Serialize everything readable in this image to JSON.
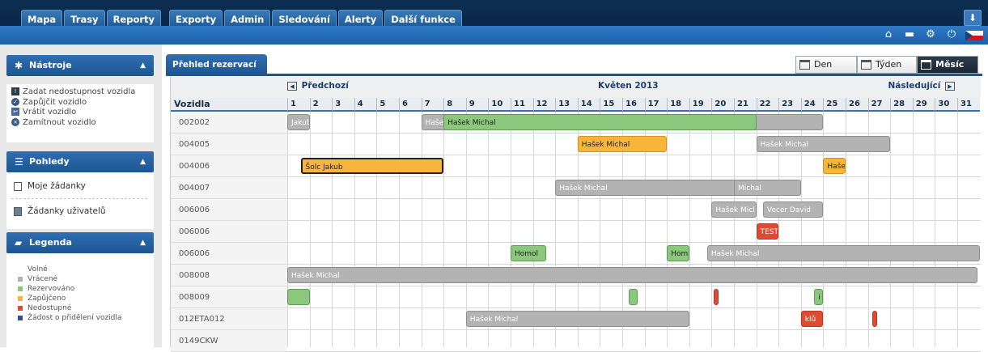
{
  "nav": [
    "Mapa",
    "Trasy",
    "Reporty",
    "Exporty",
    "Admin",
    "Sledování",
    "Alerty",
    "Další funkce"
  ],
  "tools_panel": {
    "title": "Nástroje",
    "items": [
      "Zadat nedostupnost vozidla",
      "Zapůjčit vozidlo",
      "Vrátit vozidlo",
      "Zamítnout vozidlo"
    ]
  },
  "views_panel": {
    "title": "Pohledy",
    "items": [
      "Moje žádanky",
      "Žádanky uživatelů"
    ]
  },
  "legend_panel": {
    "title": "Legenda",
    "items": [
      {
        "label": "Volné",
        "color": "#ffffff"
      },
      {
        "label": "Vrácené",
        "color": "#b3b3b3"
      },
      {
        "label": "Rezervováno",
        "color": "#8bc77c"
      },
      {
        "label": "Zapůjčeno",
        "color": "#f8b53c"
      },
      {
        "label": "Nedostupné",
        "color": "#e04a32"
      },
      {
        "label": "Žádost o přidělení vozidla",
        "color": "#2f4fa0"
      }
    ]
  },
  "tab": {
    "label": "Přehled rezervací"
  },
  "view_switch": {
    "day": "Den",
    "week": "Týden",
    "month": "Měsíc",
    "active": "month"
  },
  "calendar": {
    "prev_label": "Předchozí",
    "next_label": "Následující",
    "month_label": "Květen 2013",
    "vehicle_header": "Vozidla",
    "days": [
      1,
      2,
      3,
      4,
      5,
      6,
      7,
      8,
      9,
      10,
      11,
      12,
      13,
      14,
      15,
      16,
      17,
      18,
      19,
      20,
      21,
      22,
      23,
      24,
      25,
      26,
      27,
      28,
      29,
      30,
      31
    ],
    "vehicles": [
      "002002",
      "004005",
      "004006",
      "004007",
      "006006",
      "006006",
      "006006",
      "008008",
      "008009",
      "012ETA012",
      "0149CKW"
    ],
    "bookings": [
      {
        "row": 0,
        "start": 1,
        "end": 2,
        "status": "returned",
        "label": "Jakub"
      },
      {
        "row": 0,
        "start": 7,
        "end": 25,
        "status": "returned",
        "label": "Haše"
      },
      {
        "row": 0,
        "start": 8,
        "end": 22,
        "status": "reserved",
        "label": "Hašek Michal"
      },
      {
        "row": 1,
        "start": 14,
        "end": 18,
        "status": "borrowed",
        "label": "Hašek Michal"
      },
      {
        "row": 1,
        "start": 22,
        "end": 28,
        "status": "returned",
        "label": "Hašek Michal"
      },
      {
        "row": 2,
        "start": 1.6,
        "end": 8,
        "status": "borrowed",
        "label": "Šolc Jakub",
        "selected": true
      },
      {
        "row": 2,
        "start": 25,
        "end": 26,
        "status": "borrowed",
        "label": "Haše"
      },
      {
        "row": 3,
        "start": 13,
        "end": 24,
        "status": "returned",
        "label": "Hašek Michal"
      },
      {
        "row": 3,
        "start": 21,
        "end": 24,
        "status": "returned",
        "label": "Michal"
      },
      {
        "row": 4,
        "start": 20,
        "end": 22,
        "status": "returned",
        "label": "Hašek Micl"
      },
      {
        "row": 4,
        "start": 22.3,
        "end": 25,
        "status": "returned",
        "label": "Vecer David"
      },
      {
        "row": 5,
        "start": 22,
        "end": 23,
        "status": "unavailable",
        "label": "TEST"
      },
      {
        "row": 6,
        "start": 11,
        "end": 12.6,
        "status": "reserved",
        "label": "Homol"
      },
      {
        "row": 6,
        "start": 18,
        "end": 19,
        "status": "reserved",
        "label": "Hom"
      },
      {
        "row": 6,
        "start": 19.8,
        "end": 32,
        "status": "returned",
        "label": "Hašek Michal"
      },
      {
        "row": 7,
        "start": 1,
        "end": 31.9,
        "status": "returned",
        "label": "Hašek Michal"
      },
      {
        "row": 8,
        "start": 1,
        "end": 2,
        "status": "reserved",
        "label": ""
      },
      {
        "row": 8,
        "start": 16.3,
        "end": 16.7,
        "status": "reserved",
        "label": ""
      },
      {
        "row": 8,
        "start": 20.1,
        "end": 20.2,
        "status": "unavailable",
        "label": ""
      },
      {
        "row": 8,
        "start": 24.6,
        "end": 25,
        "status": "reserved",
        "label": "i"
      },
      {
        "row": 9,
        "start": 9,
        "end": 19,
        "status": "returned",
        "label": "Hašek Michal"
      },
      {
        "row": 9,
        "start": 24,
        "end": 25,
        "status": "unavailable",
        "label": "klů"
      },
      {
        "row": 9,
        "start": 27.2,
        "end": 27.3,
        "status": "unavailable",
        "label": ""
      }
    ]
  }
}
